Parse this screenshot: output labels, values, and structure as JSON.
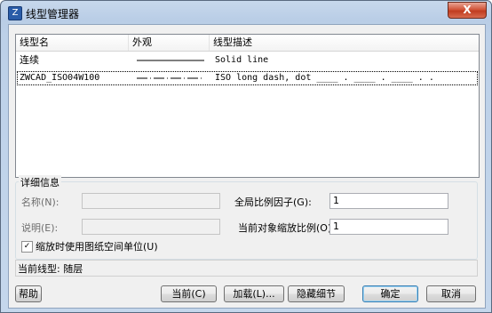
{
  "window": {
    "title": "线型管理器",
    "close_label": "X"
  },
  "table": {
    "columns": [
      "线型名",
      "外观",
      "线型描述"
    ],
    "rows": [
      {
        "name": "连续",
        "appearance": "continuous",
        "description": "Solid line"
      },
      {
        "name": "ZWCAD_ISO04W100",
        "appearance": "long-dash-dot",
        "description": "ISO long dash, dot ____ . ____ . ____ . ."
      }
    ]
  },
  "details": {
    "legend": "详细信息",
    "name_label": "名称(N):",
    "name_value": "",
    "desc_label": "说明(E):",
    "desc_value": "",
    "global_scale_label": "全局比例因子(G):",
    "global_scale_value": "1",
    "object_scale_label": "当前对象缩放比例(O):",
    "object_scale_value": "1",
    "paper_space_label": "缩放时使用图纸空间单位(U)",
    "paper_space_checked": true
  },
  "status": {
    "text": "当前线型:  随层"
  },
  "buttons": {
    "help": "帮助",
    "current": "当前(C)",
    "load": "加载(L)...",
    "hide_details": "隐藏细节",
    "ok": "确定",
    "cancel": "取消"
  }
}
